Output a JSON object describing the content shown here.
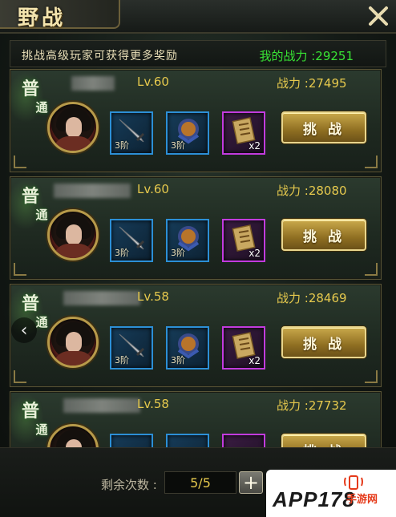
{
  "window": {
    "title": "野战"
  },
  "header": {
    "tip": "挑战高级玩家可获得更多奖励",
    "my_power": "我的战力 :29251"
  },
  "badge": {
    "char1": "普",
    "char2": "通"
  },
  "opponents": [
    {
      "level": "Lv.60",
      "power": "战力 :27495",
      "weapon_tier": "3阶",
      "armor_tier": "3阶",
      "scroll_qty": "x2",
      "button": "挑 战"
    },
    {
      "level": "Lv.60",
      "power": "战力 :28080",
      "weapon_tier": "3阶",
      "armor_tier": "3阶",
      "scroll_qty": "x2",
      "button": "挑 战"
    },
    {
      "level": "Lv.58",
      "power": "战力 :28469",
      "weapon_tier": "3阶",
      "armor_tier": "3阶",
      "scroll_qty": "x2",
      "button": "挑 战"
    },
    {
      "level": "Lv.58",
      "power": "战力 :27732",
      "weapon_tier": "",
      "armor_tier": "",
      "scroll_qty": "",
      "button": "挑 战"
    }
  ],
  "footer": {
    "remaining_label": "剩余次数 :",
    "remaining_value": "5/5",
    "add_symbol": "+"
  },
  "nav": {
    "prev_symbol": "‹"
  },
  "watermark": {
    "brand": "APP178",
    "sub": "手游网"
  },
  "colors": {
    "accent_gold": "#e6c94d",
    "power_green": "#38e234",
    "slot_blue": "#2c8fd6",
    "slot_purple": "#c23bde"
  }
}
